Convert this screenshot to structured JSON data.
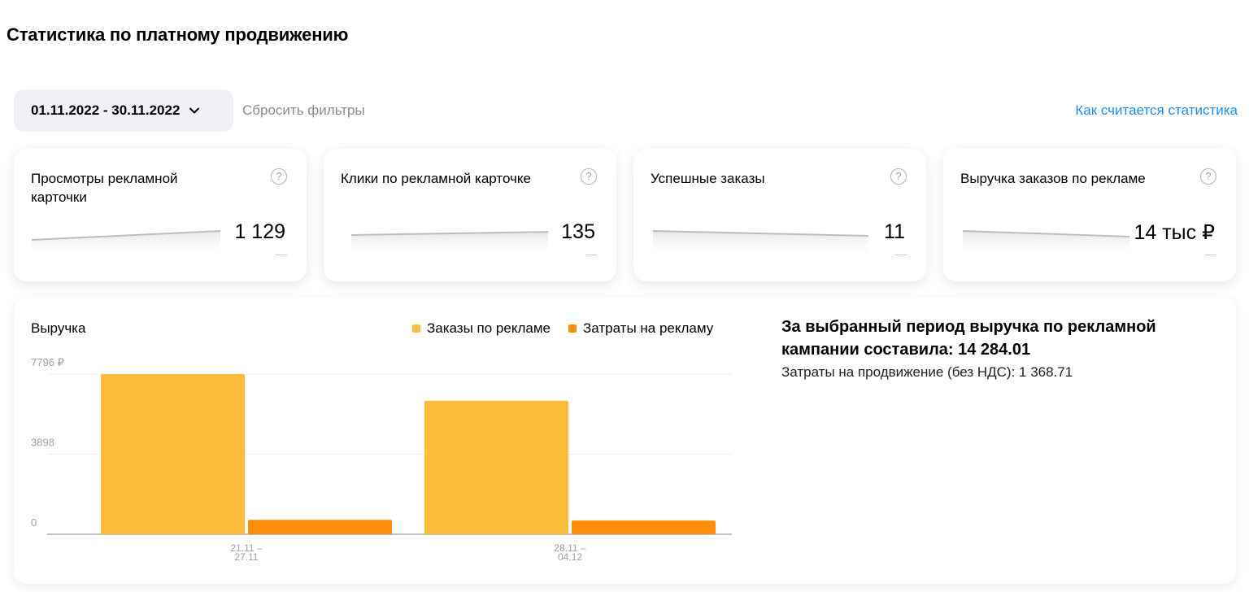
{
  "page": {
    "title": "Статистика по платному продвижению"
  },
  "filters": {
    "date_range": "01.11.2022 - 30.11.2022",
    "reset_label": "Сбросить фильтры",
    "help_link": "Как считается статистика"
  },
  "metrics": [
    {
      "label": "Просмотры рекламной карточки",
      "value": "1 129",
      "trend": "up",
      "empty": "—"
    },
    {
      "label": "Клики по рекламной карточке",
      "value": "135",
      "trend": "up",
      "empty": "—"
    },
    {
      "label": "Успешные заказы",
      "value": "11",
      "trend": "down",
      "empty": "—"
    },
    {
      "label": "Выручка заказов по рекламе",
      "value": "14 тыс ₽",
      "trend": "down",
      "empty": "—"
    }
  ],
  "help_icon_glyph": "?",
  "chart": {
    "title": "Выручка",
    "legend": [
      {
        "label": "Заказы по рекламе",
        "color": "#fbbb3b"
      },
      {
        "label": "Затраты на рекламу",
        "color": "#ff8c0a"
      }
    ]
  },
  "chart_data": {
    "type": "bar",
    "categories": [
      [
        "21.11 –",
        "27.11"
      ],
      [
        "28.11 –",
        "04.12"
      ]
    ],
    "series": [
      {
        "name": "Заказы по рекламе",
        "values": [
          7796,
          6500
        ],
        "color": "#fbbb3b"
      },
      {
        "name": "Затраты на рекламу",
        "values": [
          700,
          670
        ],
        "color": "#ff8c0a"
      }
    ],
    "yticks": [
      "7796 ₽",
      "3898",
      "0"
    ],
    "ytick_values": [
      7796,
      3898,
      0
    ],
    "ylim": [
      0,
      7796
    ],
    "grid": true,
    "legend_position": "top-right"
  },
  "summary": {
    "title": "За выбранный период выручка по рекламной кампании составила: 14 284.01",
    "subtitle": "Затраты на продвижение (без НДС): 1 368.71"
  }
}
